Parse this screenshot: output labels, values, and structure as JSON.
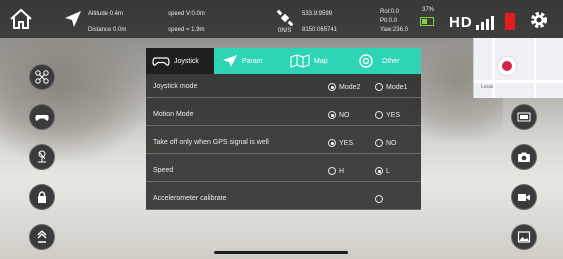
{
  "status": {
    "altitude": "Altitude 0.4m",
    "distance": "Distance 0.0m",
    "speed_v": "speed V:0.0m",
    "speed_h": "speed = 1.9m",
    "gps_sat": "0N/S",
    "coord_lat": "533.9:9599",
    "coord_lon": "8150:065741",
    "roll": "Rol:0.0",
    "pitch": "Pit:0.0",
    "yaw": "Yaw:236.0",
    "battery_pct": "37%",
    "link_label": "HD"
  },
  "map": {
    "label": "Local",
    "pin_color": "#d3234a"
  },
  "tabs": [
    {
      "label": "Joystick",
      "icon": "gamepad-icon",
      "active": true
    },
    {
      "label": "Param",
      "icon": "paper-plane-icon",
      "active": false
    },
    {
      "label": "Map",
      "icon": "map-icon",
      "active": false
    },
    {
      "label": "Other",
      "icon": "settings-icon",
      "active": false
    }
  ],
  "settings": {
    "joystick_mode": {
      "label": "Joystick mode",
      "options": [
        "Mode2",
        "Mode1"
      ],
      "selected": "Mode2"
    },
    "motion_mode": {
      "label": "Motion Mode",
      "options": [
        "NO",
        "YES"
      ],
      "selected": "NO"
    },
    "gps_takeoff": {
      "label": "Take off only when GPS signal is well",
      "options": [
        "YES",
        "NO"
      ],
      "selected": "YES"
    },
    "speed": {
      "label": "Speed",
      "options": [
        "H",
        "L"
      ],
      "selected": "L"
    },
    "accel": {
      "label": "Accelerometer calibrate"
    }
  },
  "left_buttons": [
    "drone-icon",
    "gamepad-icon",
    "landing-icon",
    "lock-icon",
    "takeoff-icon"
  ],
  "right_buttons": [
    "camera-settings-icon",
    "camera-icon",
    "video-icon",
    "gallery-icon"
  ],
  "colors": {
    "accent": "#2ed4b6",
    "battery": "#7cd43a",
    "sd_card": "#e51c1c"
  }
}
